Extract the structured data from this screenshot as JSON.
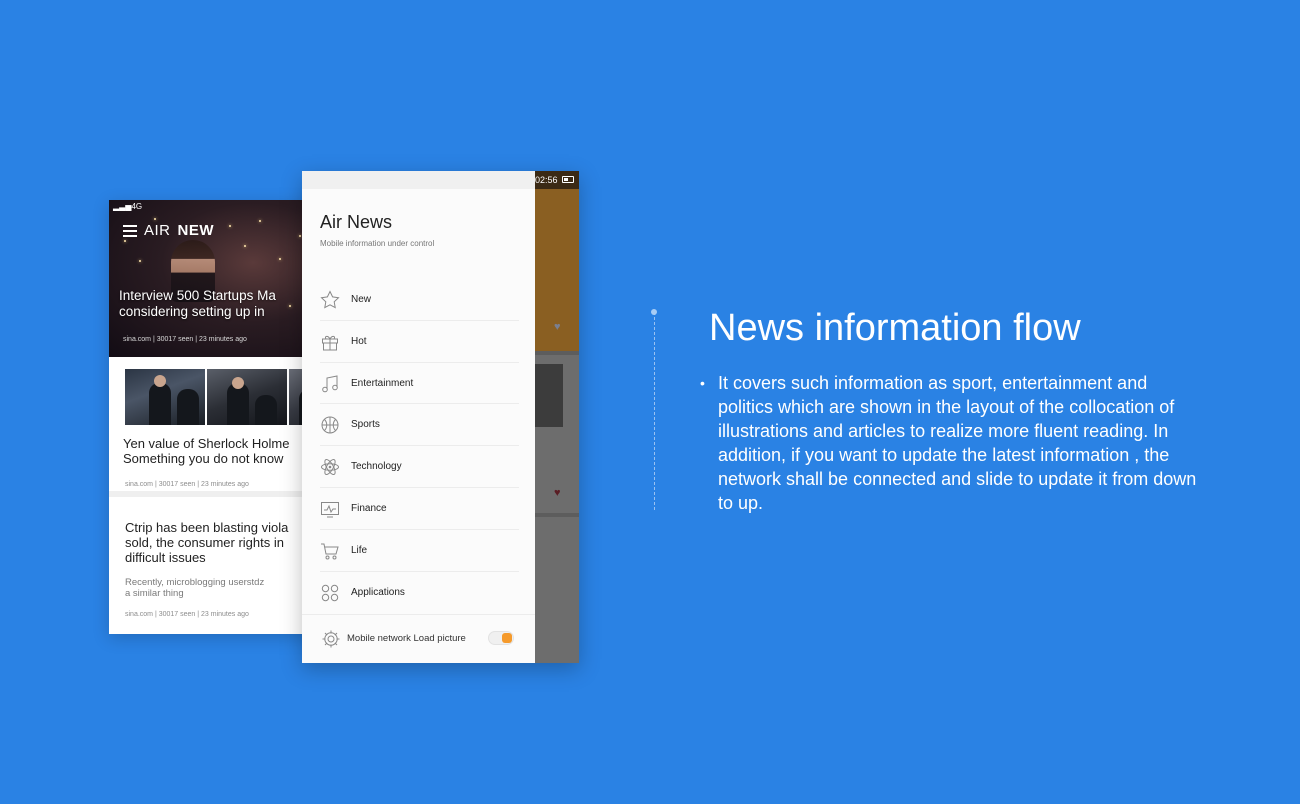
{
  "colors": {
    "background": "#2a82e4",
    "toggle_on": "#f59a2b",
    "drawer_bg": "#fbfbfb"
  },
  "back_phone": {
    "status": "4G",
    "brand_air": "AIR",
    "brand_new": "NEW",
    "hero_headline_1": "Interview 500 Startups Ma",
    "hero_headline_2": "considering setting up in",
    "hero_meta": "sina.com | 30017 seen | 23 minutes ago",
    "card1_title_1": "Yen value of Sherlock Holme",
    "card1_title_2": "Something you do not know",
    "card1_meta": "sina.com | 30017 seen | 23 minutes ago",
    "card2_title_1": "Ctrip has been blasting viola",
    "card2_title_2": "sold, the consumer rights in",
    "card2_title_3": "difficult issues",
    "card2_sub_1": "Recently, microblogging userstdz",
    "card2_sub_2": "a similar thing",
    "card2_meta": "sina.com | 30017 seen | 23 minutes ago"
  },
  "front_phone": {
    "time": "02:56",
    "app_title": "Air News",
    "app_subtitle": "Mobile information under control",
    "menu": [
      {
        "label": "New",
        "icon": "star-icon"
      },
      {
        "label": "Hot",
        "icon": "gift-icon"
      },
      {
        "label": "Entertainment",
        "icon": "music-icon"
      },
      {
        "label": "Sports",
        "icon": "ball-icon"
      },
      {
        "label": "Technology",
        "icon": "atom-icon"
      },
      {
        "label": "Finance",
        "icon": "chart-icon"
      },
      {
        "label": "Life",
        "icon": "cart-icon"
      },
      {
        "label": "Applications",
        "icon": "apps-icon"
      }
    ],
    "setting_label": "Mobile network Load picture",
    "setting_enabled": true
  },
  "feature": {
    "title": "News information flow",
    "bullet": "•",
    "description": "It covers such information as sport, entertainment and politics which are shown in the layout of the collocation of illustrations and articles to realize more fluent reading. In addition, if you want to update the latest information , the network shall be connected and slide to update it from down to up."
  }
}
